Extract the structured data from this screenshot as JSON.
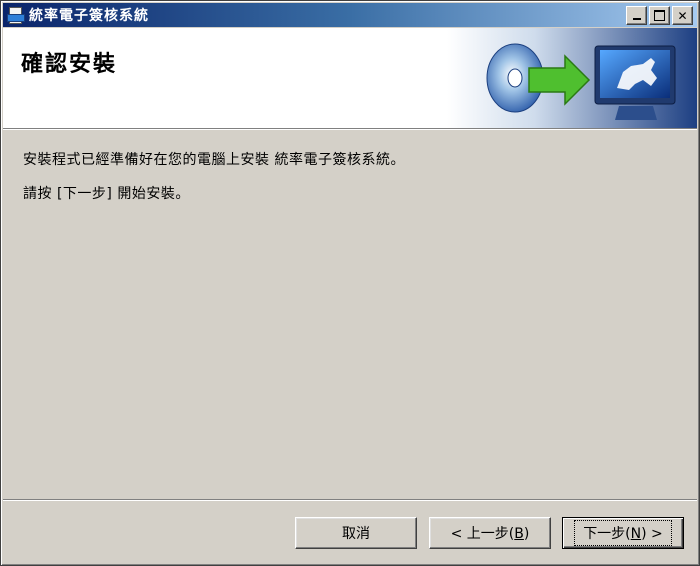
{
  "window": {
    "title": "統率電子簽核系統",
    "controls": {
      "minimize": "_",
      "maximize": "□",
      "close": "✕"
    }
  },
  "header": {
    "title": "確認安裝",
    "banner_icon": "install-banner-icon"
  },
  "body": {
    "line1": "安裝程式已經準備好在您的電腦上安裝 統率電子簽核系統。",
    "line2": "請按 [下一步] 開始安裝。"
  },
  "buttons": {
    "cancel": "取消",
    "back_pre": "< 上一步(",
    "back_key": "B",
    "back_post": ")",
    "next_pre": "下一步(",
    "next_key": "N",
    "next_post": ") >"
  },
  "colors": {
    "titlebar_start": "#0a246a",
    "titlebar_end": "#a6caf0",
    "face": "#d4d0c8",
    "arrow": "#4fbf2f"
  }
}
